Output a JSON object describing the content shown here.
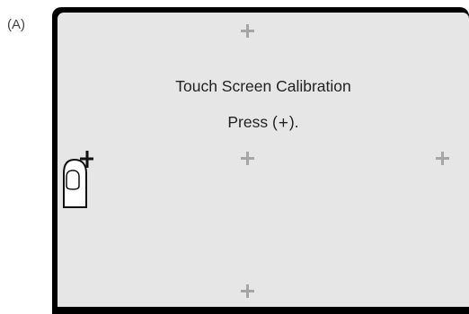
{
  "figure": {
    "label": "(A)"
  },
  "screen": {
    "title": "Touch Screen Calibration",
    "prompt_prefix": "Press (",
    "prompt_symbol": "+",
    "prompt_suffix": ")."
  },
  "icons": {
    "targets": [
      "plus-icon",
      "plus-icon",
      "plus-icon",
      "plus-icon"
    ],
    "pointer": "finger-pointer-icon"
  },
  "colors": {
    "frame": "#000000",
    "screen_background": "#e6e6e6",
    "target": "#a5a5a5",
    "text": "#222222"
  }
}
